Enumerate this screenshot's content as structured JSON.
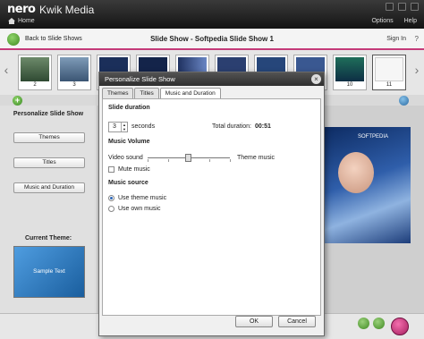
{
  "app": {
    "brand": "nero",
    "name": "Kwik Media",
    "home": "Home",
    "options": "Options",
    "help": "Help"
  },
  "header": {
    "back_label": "Back to Slide Shows",
    "title": "Slide Show - Softpedia Slide Show 1",
    "signin": "Sign In",
    "help_glyph": "?"
  },
  "filmstrip": {
    "thumbs": [
      {
        "num": "2"
      },
      {
        "num": "3"
      },
      {
        "num": ""
      },
      {
        "num": ""
      },
      {
        "num": ""
      },
      {
        "num": ""
      },
      {
        "num": ""
      },
      {
        "num": ""
      },
      {
        "num": "10"
      },
      {
        "num": "11"
      }
    ]
  },
  "left_panel": {
    "title": "Personalize Slide Show",
    "buttons": {
      "themes": "Themes",
      "titles": "Titles",
      "music": "Music and Duration"
    },
    "current_theme_label": "Current Theme:",
    "theme_preview_text": "Sample Text"
  },
  "preview": {
    "brand_text": "SOFTPEDIA"
  },
  "dialog": {
    "title": "Personalize Slide Show",
    "tabs": {
      "themes": "Themes",
      "titles": "Titles",
      "music": "Music and Duration"
    },
    "slide_duration": {
      "heading": "Slide duration",
      "value": "3",
      "unit": "seconds",
      "total_label": "Total duration:",
      "total_value": "00:51"
    },
    "music_volume": {
      "heading": "Music Volume",
      "left_label": "Video sound",
      "right_label": "Theme music",
      "mute_label": "Mute music",
      "level": 0.45
    },
    "music_source": {
      "heading": "Music source",
      "option_theme": "Use theme music",
      "option_own": "Use own music"
    },
    "buttons": {
      "ok": "OK",
      "cancel": "Cancel"
    }
  },
  "icons": [
    "home-icon",
    "back-arrow-icon",
    "add-icon",
    "close-icon",
    "play-icon"
  ]
}
